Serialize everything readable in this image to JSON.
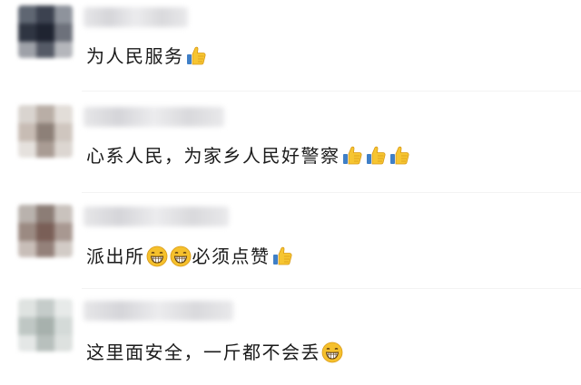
{
  "comments": [
    {
      "text_before": "为人民服务",
      "text_after": ""
    },
    {
      "text_before": "心系人民，为家乡人民好警察",
      "text_after": ""
    },
    {
      "text_before": "派出所",
      "text_mid": "必须点赞",
      "text_after": ""
    },
    {
      "text_before": "这里面安全，一斤都不会丢",
      "text_after": ""
    }
  ],
  "emoji": {
    "thumbs_up": "thumbs-up-icon",
    "grin": "grinning-face-icon"
  },
  "colors": {
    "text": "#1a1a1a",
    "thumb_yellow": "#f6c531",
    "cuff_blue": "#3f7fc7",
    "grin_yellow": "#f5c02c"
  }
}
